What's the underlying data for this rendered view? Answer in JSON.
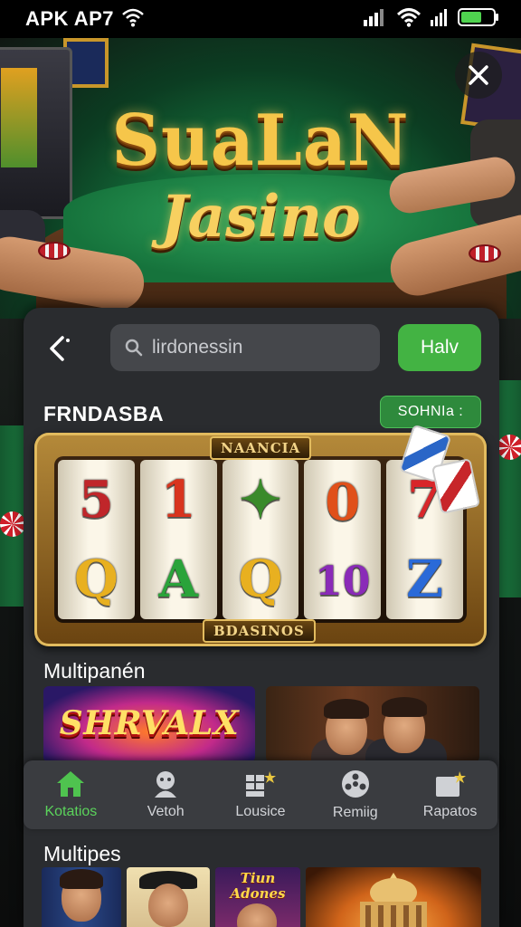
{
  "status_bar": {
    "carrier": "APK AP7"
  },
  "hero": {
    "title_line1": "SuaLaN",
    "title_line2": "Jasino"
  },
  "search": {
    "value": "lirdonessin",
    "button_label": "Halv"
  },
  "featured": {
    "title": "FRNDASBA",
    "badge": "SOHNIa :",
    "slot": {
      "top_plate": "NAANCIA",
      "bottom_plate": "BDASINOS",
      "reels": [
        [
          {
            "symbol": "5",
            "color": "#c0262a"
          },
          {
            "symbol": "Q",
            "color": "#e8b020"
          }
        ],
        [
          {
            "symbol": "1",
            "color": "#d8341e"
          },
          {
            "symbol": "A",
            "color": "#2aa33a"
          }
        ],
        [
          {
            "symbol": "✦",
            "color": "#3a8a2a"
          },
          {
            "symbol": "Q",
            "color": "#e8b020"
          }
        ],
        [
          {
            "symbol": "0",
            "color": "#e0501a"
          },
          {
            "symbol": "10",
            "color": "#8a2ab8"
          }
        ],
        [
          {
            "symbol": "7",
            "color": "#d8262a"
          },
          {
            "symbol": "Z",
            "color": "#2a6ad8"
          }
        ]
      ]
    }
  },
  "multiplayer": {
    "title": "Multipanén",
    "tiles": [
      {
        "logo": "SHRVALX"
      },
      {
        "logo": ""
      }
    ]
  },
  "nav": [
    {
      "label": "Kotatios",
      "icon": "home-icon",
      "active": true
    },
    {
      "label": "Vetoh",
      "icon": "person-icon",
      "active": false
    },
    {
      "label": "Lousice",
      "icon": "grid-icon",
      "active": false
    },
    {
      "label": "Remiig",
      "icon": "poker-chip-icon",
      "active": false
    },
    {
      "label": "Rapatos",
      "icon": "ticket-icon",
      "active": false
    }
  ],
  "multipes": {
    "title": "Multipes",
    "thumbs": [
      {
        "logo": ""
      },
      {
        "logo": ""
      },
      {
        "logo": "Tiun Adones"
      },
      {
        "logo": ""
      }
    ]
  },
  "colors": {
    "accent_green": "#43b343",
    "panel_bg": "#2a2c2f",
    "gold": "#f6c64a"
  }
}
